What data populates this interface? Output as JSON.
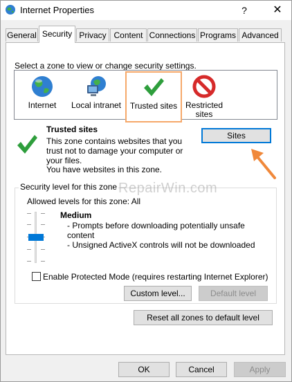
{
  "window": {
    "title": "Internet Properties",
    "help_glyph": "?",
    "close_glyph": "✕"
  },
  "tabs": [
    {
      "label": "General"
    },
    {
      "label": "Security"
    },
    {
      "label": "Privacy"
    },
    {
      "label": "Content"
    },
    {
      "label": "Connections"
    },
    {
      "label": "Programs"
    },
    {
      "label": "Advanced"
    }
  ],
  "active_tab": "Security",
  "zones_prompt": "Select a zone to view or change security settings.",
  "zones": [
    {
      "label": "Internet",
      "icon": "globe-icon"
    },
    {
      "label": "Local intranet",
      "icon": "network-computer-icon"
    },
    {
      "label": "Trusted sites",
      "icon": "green-check-icon"
    },
    {
      "label": "Restricted sites",
      "icon": "restricted-icon"
    }
  ],
  "selected_zone": "Trusted sites",
  "zone_info": {
    "title": "Trusted sites",
    "description": "This zone contains websites that you trust not to damage your computer or your files.",
    "note": "You have websites in this zone.",
    "sites_button": "Sites"
  },
  "security_level": {
    "group_label": "Security level for this zone",
    "allowed": "Allowed levels for this zone: All",
    "level_name": "Medium",
    "bullets": [
      "- Prompts before downloading potentially unsafe content",
      "- Unsigned ActiveX controls will not be downloaded"
    ],
    "slider_level_index": 1,
    "slider_levels": 5
  },
  "protected_mode": {
    "label": "Enable Protected Mode (requires restarting Internet Explorer)",
    "checked": false
  },
  "buttons": {
    "custom_level": "Custom level...",
    "default_level": "Default level",
    "reset_all": "Reset all zones to default level",
    "ok": "OK",
    "cancel": "Cancel",
    "apply": "Apply"
  },
  "watermark": "RepairWin.com",
  "colors": {
    "accent": "#0078d7",
    "selection_border": "#f6a869",
    "arrow": "#f0883a",
    "check_green": "#2e9e3c"
  }
}
